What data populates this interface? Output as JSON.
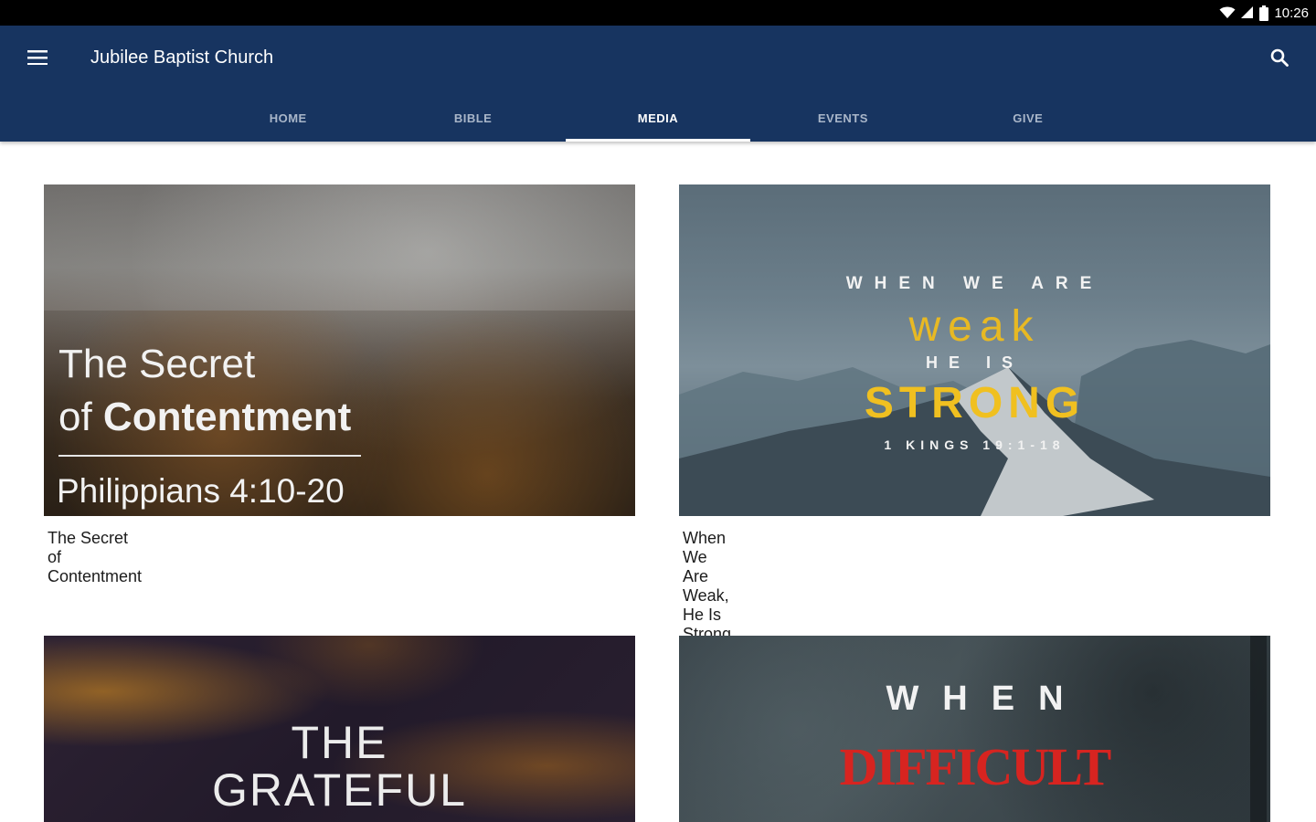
{
  "status_bar": {
    "time": "10:26"
  },
  "app_bar": {
    "title": "Jubilee Baptist Church"
  },
  "tabs": [
    {
      "label": "HOME",
      "active": false
    },
    {
      "label": "BIBLE",
      "active": false
    },
    {
      "label": "MEDIA",
      "active": true
    },
    {
      "label": "EVENTS",
      "active": false
    },
    {
      "label": "GIVE",
      "active": false
    }
  ],
  "media_items": [
    {
      "caption": "The Secret of Contentment",
      "artwork_lines": [
        "The Secret",
        "of ",
        "Contentment",
        "Philippians 4:10-20"
      ]
    },
    {
      "caption": "When We Are Weak, He Is Strong",
      "artwork_lines": [
        "WHEN WE ARE",
        "weak",
        "HE IS",
        "STRONG",
        "1 KINGS 19:1-18"
      ]
    },
    {
      "caption": "",
      "artwork_lines": [
        "THE",
        "GRATEFUL"
      ]
    },
    {
      "caption": "",
      "artwork_lines": [
        "WHEN",
        "DIFFICULT"
      ]
    }
  ],
  "colors": {
    "app_bar": "#173460",
    "status_bar": "#000000",
    "tab_inactive": "#a9b6c9",
    "tab_active": "#ffffff",
    "accent_yellow": "#f0c020",
    "accent_red": "#d72420"
  },
  "icons": [
    "wifi-icon",
    "signal-icon",
    "battery-icon",
    "menu-icon",
    "search-icon"
  ]
}
